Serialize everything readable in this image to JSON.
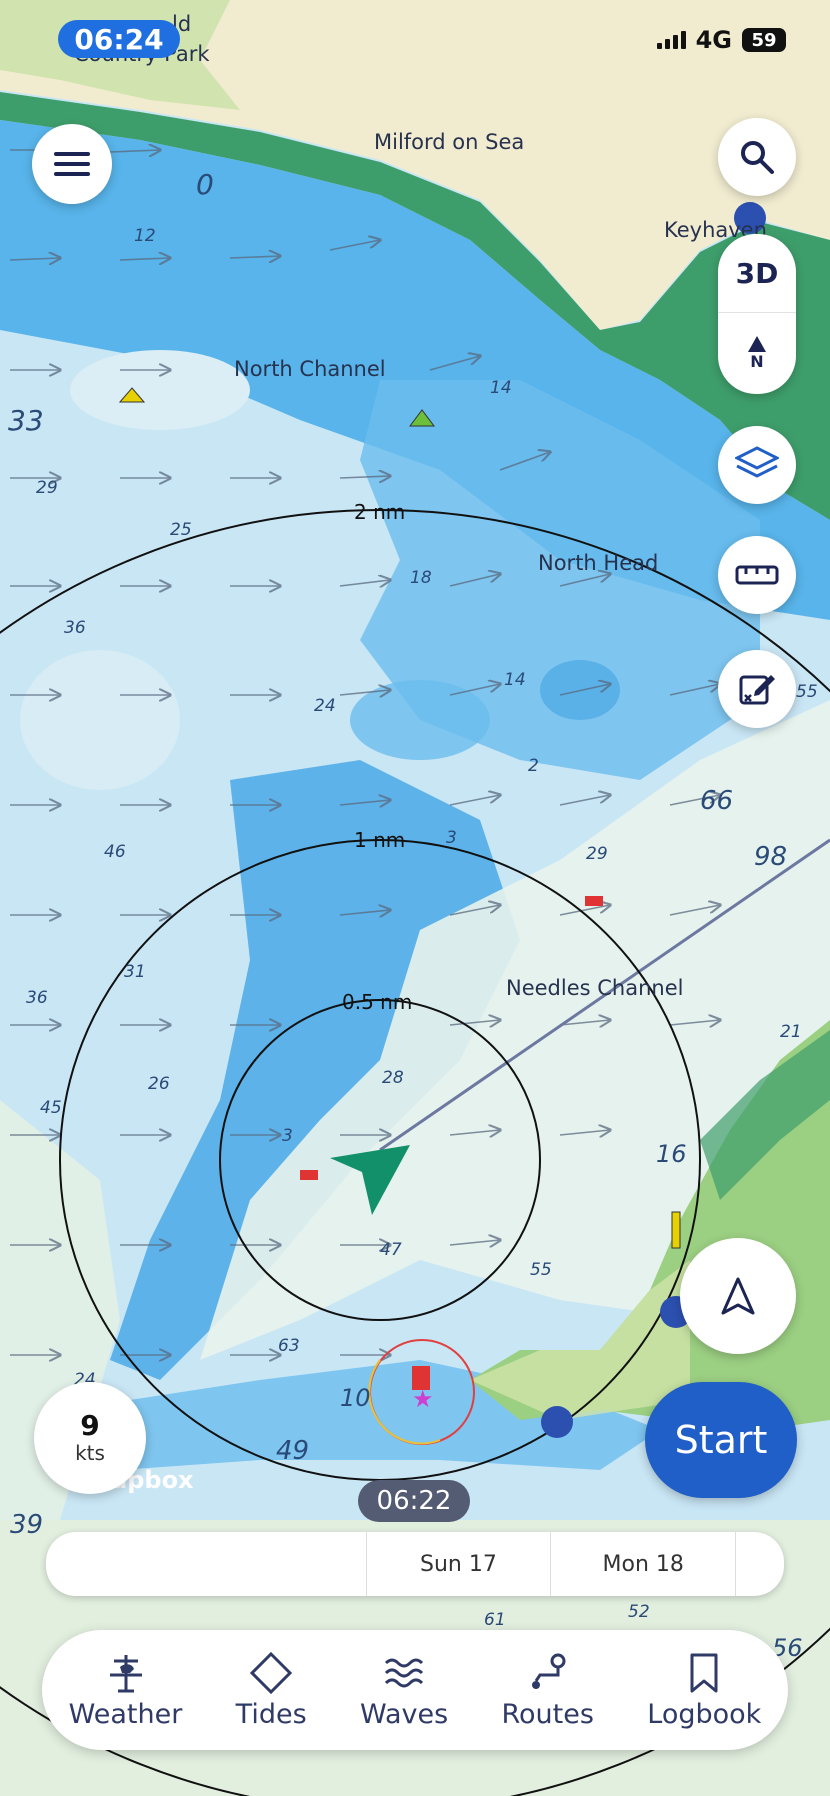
{
  "status_bar": {
    "time": "06:24",
    "network": "4G",
    "battery": "59"
  },
  "map": {
    "places": {
      "milford": "Milford on Sea",
      "keyhaven": "Keyhaven",
      "country_park_1": "ld",
      "country_park_2": "Country Park",
      "north_channel": "North Channel",
      "north_head": "North Head",
      "needles_channel": "Needles Channel",
      "attribution": "mapbox"
    },
    "depths": [
      "12",
      "33",
      "29",
      "25",
      "36",
      "46",
      "31",
      "36",
      "26",
      "45",
      "24",
      "49",
      "39",
      "14",
      "18",
      "14",
      "2",
      "24",
      "3",
      "29",
      "28",
      "3",
      "47",
      "55",
      "63",
      "10",
      "21",
      "55",
      "66",
      "98",
      "16",
      "61",
      "52",
      "56",
      "0"
    ],
    "range_rings": {
      "outer": "2 nm",
      "middle": "1 nm",
      "inner": "0.5 nm"
    }
  },
  "controls": {
    "menu": "menu-icon",
    "search": "search-icon",
    "view_3d": "3D",
    "north": "N",
    "layers": "layers-icon",
    "measure": "ruler-icon",
    "edit": "edit-icon",
    "locate": "navigation-arrow-icon"
  },
  "speed": {
    "value": "9",
    "unit": "kts"
  },
  "start_label": "Start",
  "time_badge": "06:22",
  "timeline": [
    "",
    "Sun 17",
    "Mon 18",
    ""
  ],
  "nav": [
    {
      "label": "Weather",
      "icon": "weather-vane-icon"
    },
    {
      "label": "Tides",
      "icon": "diamond-icon"
    },
    {
      "label": "Waves",
      "icon": "waves-icon"
    },
    {
      "label": "Routes",
      "icon": "route-icon"
    },
    {
      "label": "Logbook",
      "icon": "bookmark-icon"
    }
  ],
  "colors": {
    "accent": "#1f5fc7",
    "land": "#f1ecd0",
    "green_land": "#3ea56a",
    "deep_water": "#bfe1f3",
    "shallow": "#5fb6ea",
    "vessel": "#11906a"
  }
}
